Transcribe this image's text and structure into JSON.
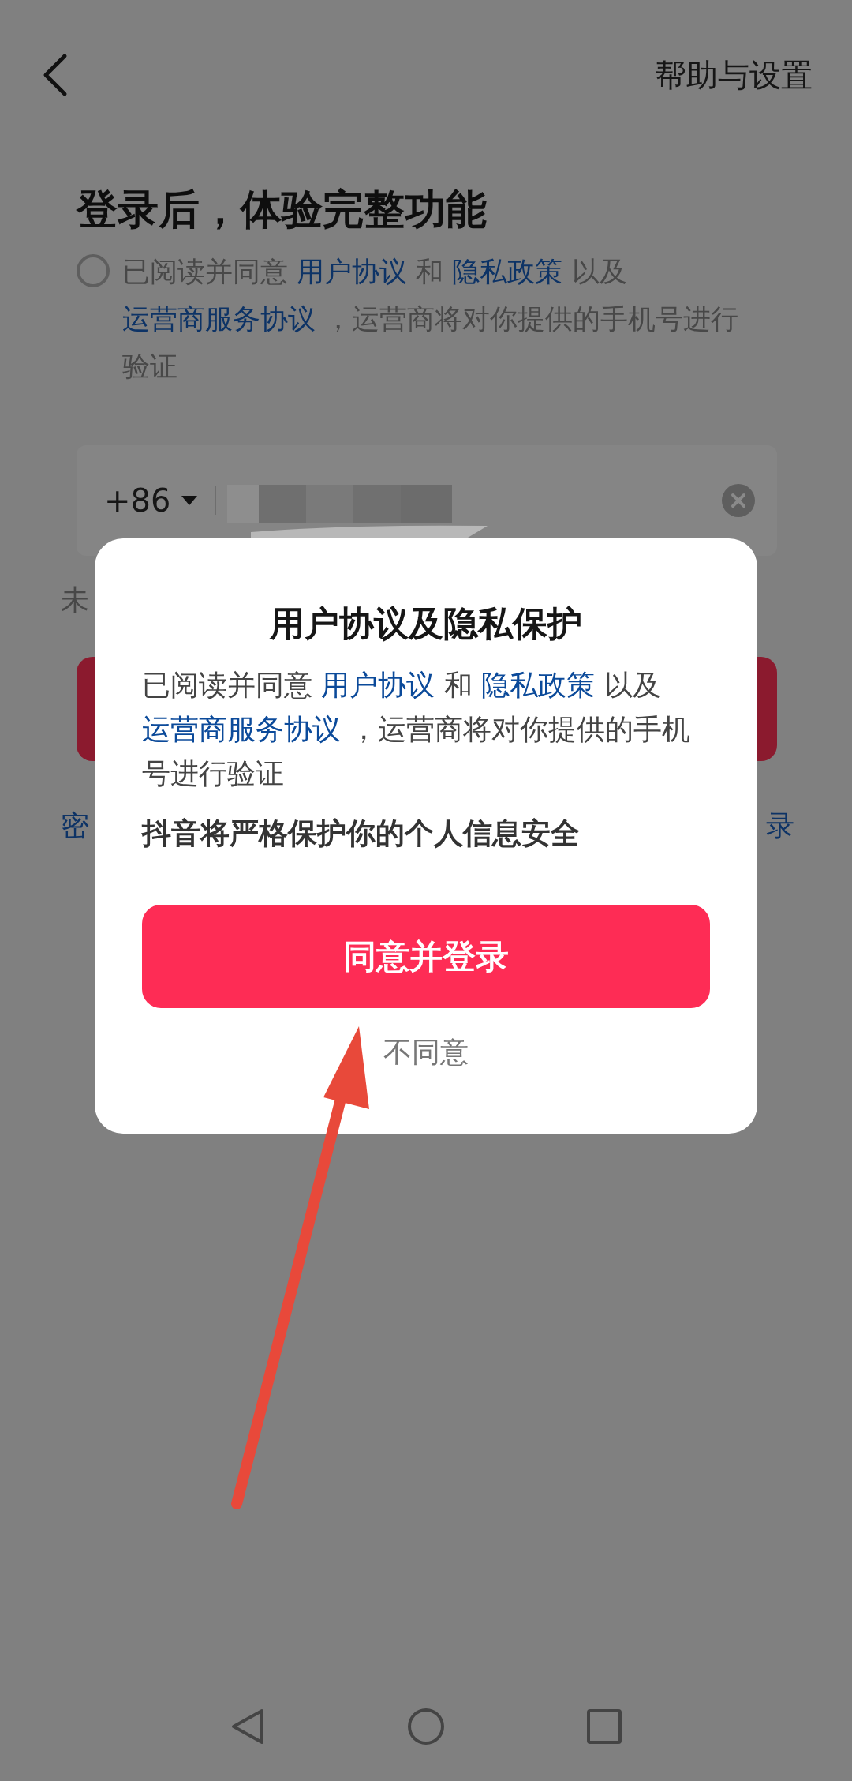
{
  "header": {
    "help_link": "帮助与设置"
  },
  "page": {
    "title": "登录后，体验完整功能",
    "agreement": {
      "checked": false,
      "segments": [
        {
          "kind": "plain",
          "text": "已阅读并同意 "
        },
        {
          "kind": "link",
          "text": "用户协议"
        },
        {
          "kind": "plain",
          "text": " 和 "
        },
        {
          "kind": "link",
          "text": "隐私政策"
        },
        {
          "kind": "plain",
          "text": " 以及 "
        },
        {
          "kind": "link",
          "text": "运营商服务协议"
        },
        {
          "kind": "plain",
          "text": " ，运营商将对你提供的手机号进行验证"
        }
      ]
    },
    "phone_field": {
      "country_code": "+86"
    },
    "hint_visible": "未",
    "bottom_left_link": "密",
    "bottom_right_link": "录"
  },
  "dialog": {
    "title": "用户协议及隐私保护",
    "body": [
      {
        "kind": "plain",
        "text": "已阅读并同意 "
      },
      {
        "kind": "link",
        "text": "用户协议"
      },
      {
        "kind": "plain",
        "text": " 和 "
      },
      {
        "kind": "link",
        "text": "隐私政策"
      },
      {
        "kind": "plain",
        "text": " 以及 "
      },
      {
        "kind": "link",
        "text": "运营商服务协议"
      },
      {
        "kind": "plain",
        "text": " ，运营商将对你提供的手机号进行验证"
      }
    ],
    "note": "抖音将严格保护你的个人信息安全",
    "agree_button": "同意并登录",
    "decline_button": "不同意"
  }
}
